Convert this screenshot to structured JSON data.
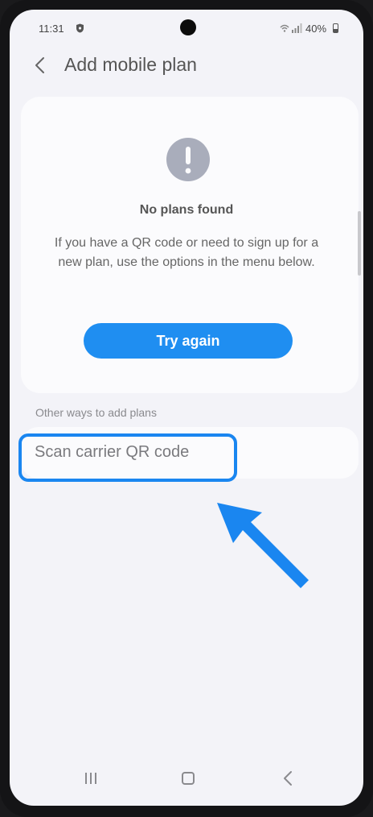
{
  "status_bar": {
    "time": "11:31",
    "battery": "40%",
    "icons": [
      "shield-icon",
      "wifi-icon",
      "signal-icon",
      "battery-icon"
    ]
  },
  "header": {
    "title": "Add mobile plan",
    "back_icon": "chevron-left-icon"
  },
  "empty_state": {
    "icon": "exclamation-circle-icon",
    "heading": "No plans found",
    "message": "If you have a QR code or need to sign up for a new plan, use the options in the menu below.",
    "retry_label": "Try again"
  },
  "other_ways": {
    "section_label": "Other ways to add plans",
    "items": [
      {
        "label": "Scan carrier QR code"
      }
    ]
  },
  "annotation": {
    "highlight_color": "#1a86f0",
    "arrow_icon": "pointer-arrow-icon"
  },
  "nav_bar": {
    "buttons": [
      "recents-icon",
      "home-icon",
      "back-icon"
    ]
  },
  "colors": {
    "accent": "#1f8ef1",
    "background": "#f3f3f8",
    "card": "#fbfbfd"
  }
}
